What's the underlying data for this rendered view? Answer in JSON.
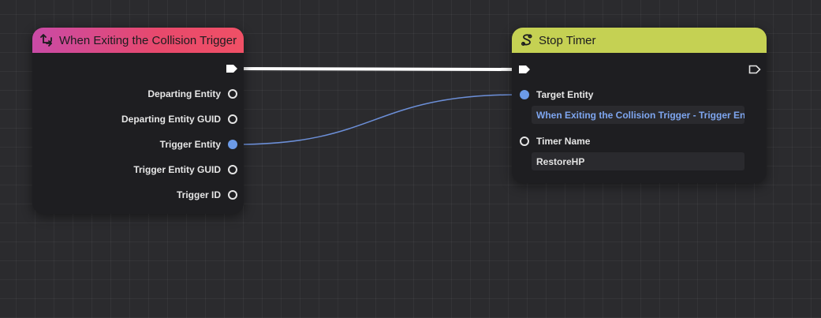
{
  "colors": {
    "canvas_background": "#2b2b2e",
    "node_body": "#1e1e21",
    "event_header_gradient_start": "#c94aa6",
    "event_header_gradient_end": "#f05066",
    "action_header": "#c5d153",
    "exec_wire": "#ffffff",
    "data_wire": "#6c9be8",
    "linked_value_text": "#7ea6f0"
  },
  "event_node": {
    "title": "When Exiting the Collision Trigger",
    "icon": "event-trigger-icon",
    "outputs": [
      {
        "label": "Departing Entity",
        "pin": "hollow",
        "connected": false
      },
      {
        "label": "Departing Entity GUID",
        "pin": "hollow",
        "connected": false
      },
      {
        "label": "Trigger Entity",
        "pin": "filled",
        "connected": true
      },
      {
        "label": "Trigger Entity GUID",
        "pin": "hollow",
        "connected": false
      },
      {
        "label": "Trigger ID",
        "pin": "hollow",
        "connected": false
      }
    ]
  },
  "action_node": {
    "title": "Stop Timer",
    "icon": "timer-node-icon",
    "inputs": [
      {
        "label": "Target Entity",
        "pin": "filled",
        "connected": true,
        "value": "When Exiting the Collision Trigger - Trigger Entity"
      },
      {
        "label": "Timer Name",
        "pin": "hollow",
        "connected": false,
        "value": "RestoreHP"
      }
    ]
  }
}
